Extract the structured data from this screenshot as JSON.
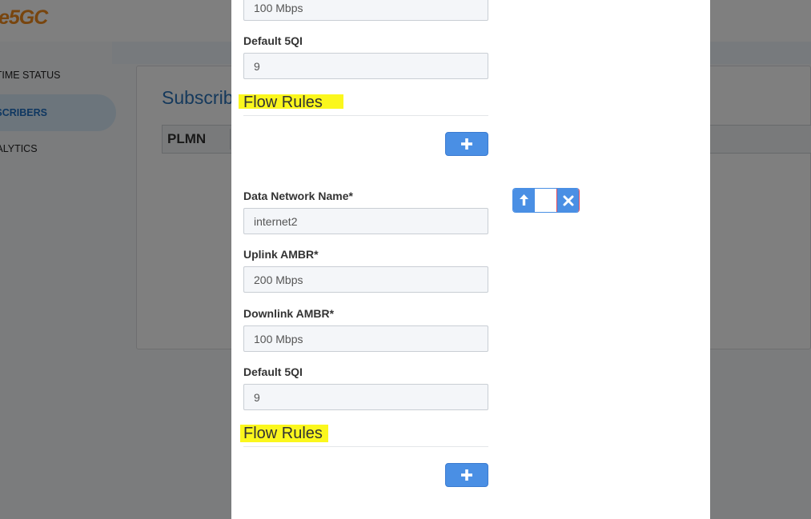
{
  "app": {
    "logo": {
      "prefix": "e",
      "brand": "5GC"
    },
    "sidebar": {
      "items": [
        {
          "label": "REALTIME STATUS",
          "active": false
        },
        {
          "label": "SUBSCRIBERS",
          "active": true
        },
        {
          "label": "ANALYTICS",
          "active": false
        }
      ]
    },
    "panel": {
      "title": "Subscribers",
      "table_headers": [
        "PLMN"
      ]
    }
  },
  "modal": {
    "top_section": {
      "downlink_ambr_value": "100 Mbps",
      "default_5qi_label": "Default 5QI",
      "default_5qi_value": "9",
      "flow_rules_title": "Flow Rules"
    },
    "session": {
      "dnn_label": "Data Network Name*",
      "dnn_value": "internet2",
      "uplink_label": "Uplink AMBR*",
      "uplink_value": "200 Mbps",
      "downlink_label": "Downlink AMBR*",
      "downlink_value": "100 Mbps",
      "default_5qi_label": "Default 5QI",
      "default_5qi_value": "9",
      "flow_rules_title": "Flow Rules"
    },
    "icons": {
      "add": "plus-icon",
      "move_up": "arrow-up-icon",
      "remove": "close-icon"
    }
  },
  "colors": {
    "accent": "#4a8fe4",
    "highlight": "#fbf71d",
    "title_blue": "#2a73b8",
    "danger_border": "#e0495a"
  }
}
